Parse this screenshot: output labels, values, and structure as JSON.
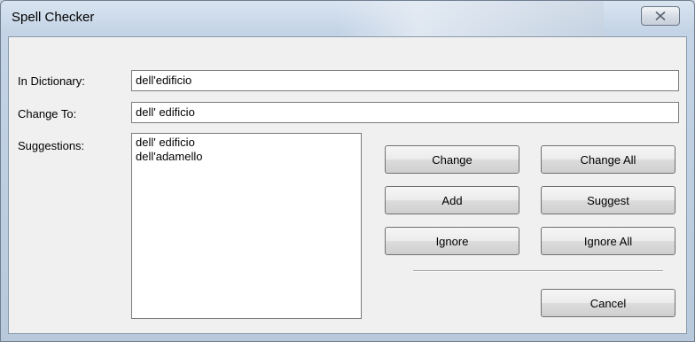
{
  "window": {
    "title": "Spell Checker"
  },
  "form": {
    "in_dictionary_label": "In Dictionary:",
    "in_dictionary_value": "dell'edificio",
    "change_to_label": "Change To:",
    "change_to_value": "dell' edificio",
    "suggestions_label": "Suggestions:",
    "suggestions": [
      "dell' edificio",
      "dell'adamello"
    ]
  },
  "buttons": {
    "change": "Change",
    "change_all": "Change All",
    "add": "Add",
    "suggest": "Suggest",
    "ignore": "Ignore",
    "ignore_all": "Ignore All",
    "cancel": "Cancel"
  },
  "icons": {
    "close": "close-icon"
  }
}
